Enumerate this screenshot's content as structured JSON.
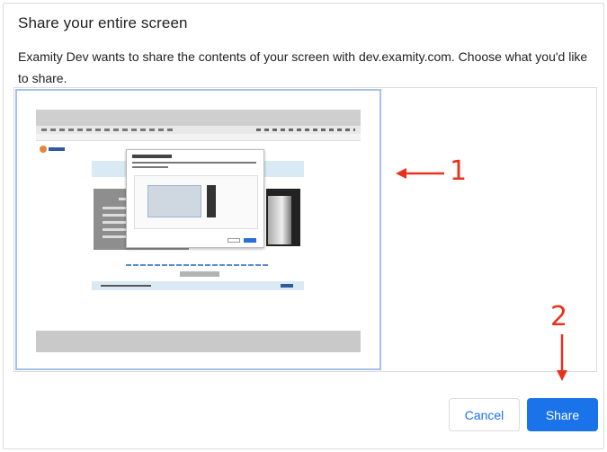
{
  "dialog": {
    "title": "Share your entire screen",
    "subtitle": "Examity Dev wants to share the contents of your screen with dev.examity.com. Choose what you'd like to share.",
    "cancel_label": "Cancel",
    "share_label": "Share"
  },
  "thumbnail": {
    "logo_text": "examity"
  },
  "annotations": {
    "label_1": "1",
    "label_2": "2",
    "color": "#e8321e"
  },
  "colors": {
    "accent": "#1a73e8",
    "selection_border": "#a7c0ea"
  }
}
